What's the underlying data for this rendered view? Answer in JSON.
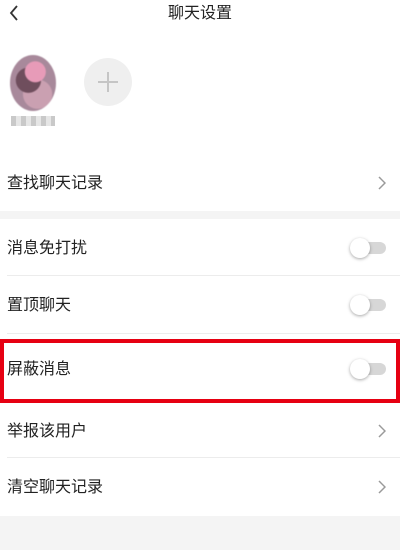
{
  "header": {
    "title": "聊天设置",
    "back_icon": "chevron-left-icon"
  },
  "members": {
    "add_icon": "plus-icon"
  },
  "rows": {
    "search_history": "查找聊天记录",
    "do_not_disturb": "消息免打扰",
    "pin_chat": "置顶聊天",
    "block_messages": "屏蔽消息",
    "report_user": "举报该用户",
    "clear_history": "清空聊天记录"
  },
  "toggles": {
    "do_not_disturb": false,
    "pin_chat": false,
    "block_messages": false
  },
  "colors": {
    "highlight": "#e60012",
    "background": "#f4f4f4",
    "toggle_track": "#d7d7d7"
  }
}
